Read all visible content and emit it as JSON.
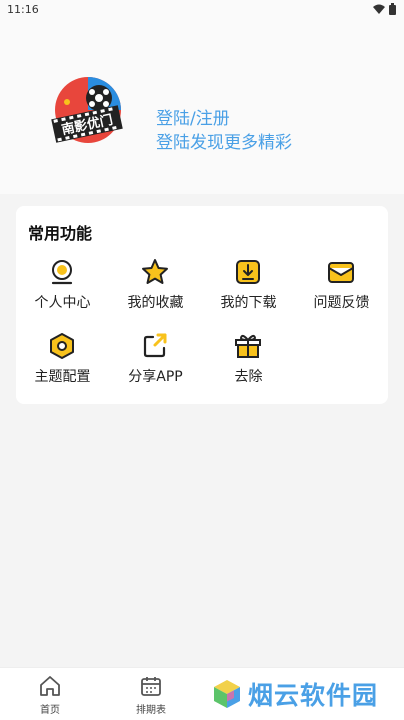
{
  "status": {
    "time": "11:16"
  },
  "profile": {
    "login_title": "登陆/注册",
    "login_subtitle": "登陆发现更多精彩",
    "logo_text": "南影优门"
  },
  "functions": {
    "title": "常用功能",
    "items": [
      {
        "label": "个人中心",
        "icon": "user-icon"
      },
      {
        "label": "我的收藏",
        "icon": "star-icon"
      },
      {
        "label": "我的下载",
        "icon": "download-icon"
      },
      {
        "label": "问题反馈",
        "icon": "mail-icon"
      },
      {
        "label": "主题配置",
        "icon": "hexagon-icon"
      },
      {
        "label": "分享APP",
        "icon": "share-icon"
      },
      {
        "label": "去除",
        "icon": "gift-icon"
      }
    ]
  },
  "tabbar": {
    "home_label": "首页",
    "schedule_label": "排期表"
  },
  "watermark": {
    "text": "烟云软件园"
  },
  "colors": {
    "accent": "#4aa0e6",
    "icon_yellow": "#f8c21c",
    "icon_dark": "#222222"
  }
}
